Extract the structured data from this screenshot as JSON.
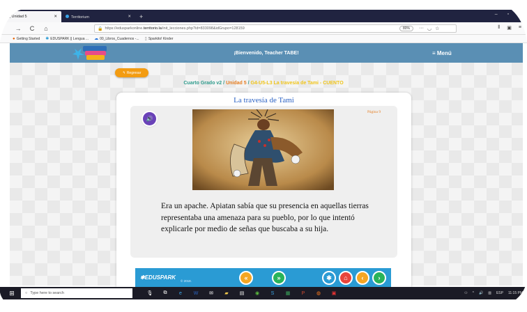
{
  "browser": {
    "tabs": [
      {
        "label": "... || Unidad 5",
        "close": "✕"
      },
      {
        "label": "Territorium",
        "close": "✕"
      }
    ],
    "newtab_label": "+",
    "window_controls": [
      "–",
      "▫",
      "✕"
    ],
    "url_scheme": "https://eduspark online.",
    "url_domain": "territorio.la",
    "url_path": "/init_lecciones.php?id=833098&idGrupo=128159",
    "url_prefix": "https://edusparkonline.",
    "zoom": "80%",
    "bookmarks": [
      {
        "icon": "firefox-icon",
        "label": "Getting Started"
      },
      {
        "icon": "star-icon",
        "label": "EDUSPARK || Lengua ..."
      },
      {
        "icon": "cloud-icon",
        "label": "00_Libros_Cuadernos -..."
      },
      {
        "icon": "page-icon",
        "label": "Sparkito! Kinder"
      }
    ]
  },
  "site": {
    "welcome": "¡Bienvenido, Teacher TABE!",
    "menu_label": "≡ Menú",
    "back_label": "Regresar",
    "breadcrumb": {
      "grade": "Cuarto Grado v2",
      "sep": " / ",
      "unit": "Unidad 5",
      "lesson": "G4-U5-L3 La travesía de Tami - CUENTO"
    },
    "story": {
      "title": "La travesía de Tami",
      "page_label": "Página 9",
      "text": "Era un apache. Apiatan sabía que su presencia en aquellas tierras representaba una amenaza para su pueblo, por lo que intentó explicarle por medio de señas que buscaba a su hija."
    },
    "footer": {
      "logo": "EDUSPARK",
      "copyright": "© 2018."
    }
  },
  "taskbar": {
    "search_placeholder": "Type here to search",
    "time": "11:15 PM",
    "lang": "ESP"
  },
  "colors": {
    "header": "#5a8fb4",
    "accent_orange": "#f39c12",
    "footer_blue": "#2a9bd4",
    "title_blue": "#2b62c4"
  }
}
